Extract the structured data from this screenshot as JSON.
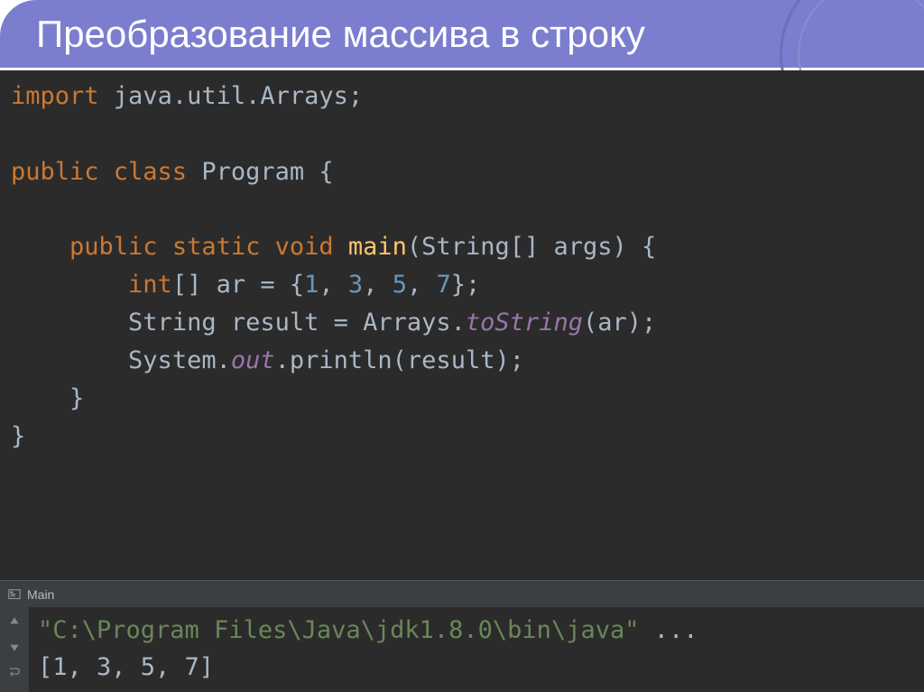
{
  "slide": {
    "title": "Преобразование массива в строку"
  },
  "code": {
    "l1_kw": "import",
    "l1_pkg": " java.util.Arrays;",
    "l3_kw1": "public class",
    "l3_name": " Program {",
    "l5_indent": "    ",
    "l5_kw": "public static void",
    "l5_method": " main",
    "l5_params": "(String[] args) {",
    "l6_indent": "        ",
    "l6_kw": "int",
    "l6_brackets": "[] ar = {",
    "l6_n1": "1",
    "l6_c": ", ",
    "l6_n2": "3",
    "l6_n3": "5",
    "l6_n4": "7",
    "l6_end": "};",
    "l7_indent": "        ",
    "l7_text1": "String result = Arrays.",
    "l7_static": "toString",
    "l7_text2": "(ar);",
    "l8_indent": "        ",
    "l8_text1": "System.",
    "l8_field": "out",
    "l8_text2": ".println(result);",
    "l9": "    }",
    "l10": "}"
  },
  "run": {
    "tabLabel": "Main"
  },
  "console": {
    "line1_str": "\"C:\\Program Files\\Java\\jdk1.8.0\\bin\\java\"",
    "line1_rest": " ...",
    "line2": "[1, 3, 5, 7]"
  }
}
